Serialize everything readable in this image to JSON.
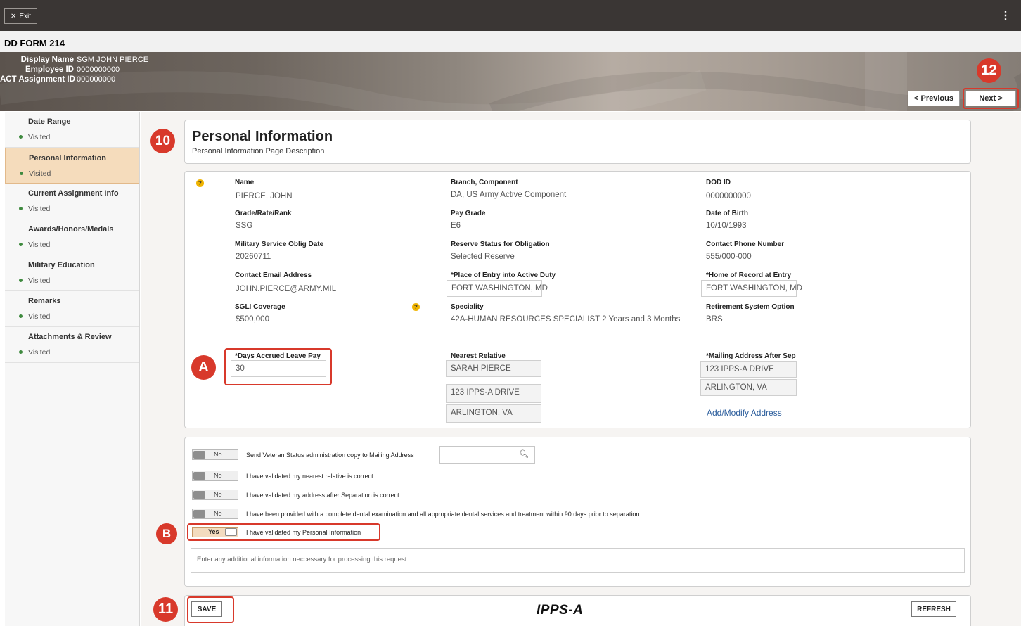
{
  "top_bar": {
    "exit_label": "Exit",
    "menu_icon": "kebab-menu-icon"
  },
  "form_title": "DD FORM 214",
  "employee": {
    "display_name_label": "Display Name",
    "display_name": "SGM JOHN PIERCE",
    "employee_id_label": "Employee ID",
    "employee_id": "0000000000",
    "assignment_id_label": "ACT Assignment ID",
    "assignment_id": "000000000"
  },
  "nav": {
    "previous_label": "< Previous",
    "next_label": "Next >"
  },
  "callouts": {
    "c10": "10",
    "c11": "11",
    "c12": "12",
    "cA": "A",
    "cB": "B"
  },
  "sidebar": {
    "items": [
      {
        "title": "Date Range",
        "status": "Visited"
      },
      {
        "title": "Personal Information",
        "status": "Visited",
        "active": true
      },
      {
        "title": "Current Assignment Info",
        "status": "Visited"
      },
      {
        "title": "Awards/Honors/Medals",
        "status": "Visited"
      },
      {
        "title": "Military Education",
        "status": "Visited"
      },
      {
        "title": "Remarks",
        "status": "Visited"
      },
      {
        "title": "Attachments & Review",
        "status": "Visited"
      }
    ]
  },
  "page": {
    "title": "Personal Information",
    "description": "Personal Information Page Description"
  },
  "fields": {
    "name": {
      "label": "Name",
      "value": "PIERCE, JOHN"
    },
    "branch": {
      "label": "Branch, Component",
      "value": "DA, US Army Active Component"
    },
    "dod_id": {
      "label": "DOD ID",
      "value": "0000000000"
    },
    "grade": {
      "label": "Grade/Rate/Rank",
      "value": "SSG"
    },
    "pay_grade": {
      "label": "Pay Grade",
      "value": "E6"
    },
    "dob": {
      "label": "Date of Birth",
      "value": "10/10/1993"
    },
    "mso_date": {
      "label": "Military Service Oblig Date",
      "value": "20260711"
    },
    "reserve_status": {
      "label": "Reserve Status for Obligation",
      "value": "Selected Reserve"
    },
    "phone": {
      "label": "Contact Phone Number",
      "value": "555/000-000"
    },
    "email": {
      "label": "Contact Email Address",
      "value": "JOHN.PIERCE@ARMY.MIL"
    },
    "place_entry": {
      "label": "*Place of Entry into Active Duty",
      "value": "FORT WASHINGTON, MD"
    },
    "home_record": {
      "label": "*Home of Record at Entry",
      "value": "FORT WASHINGTON, MD"
    },
    "sgli": {
      "label": "SGLI Coverage",
      "value": "$500,000"
    },
    "speciality": {
      "label": "Speciality",
      "value": "42A-HUMAN RESOURCES SPECIALIST 2 Years and 3 Months"
    },
    "retirement": {
      "label": "Retirement System Option",
      "value": "BRS"
    },
    "leave_pay": {
      "label": "*Days Accrued Leave Pay",
      "value": "30"
    },
    "nearest_relative": {
      "label": "Nearest Relative",
      "name": "SARAH PIERCE",
      "address1": "123 IPPS-A DRIVE",
      "address2": "ARLINGTON, VA"
    },
    "mailing_address": {
      "label": "*Mailing Address After Sep",
      "address1": "123 IPPS-A DRIVE",
      "address2": "ARLINGTON, VA"
    },
    "add_modify_link": "Add/Modify Address"
  },
  "checks": {
    "veteran_copy": {
      "state": "No",
      "label": "Send Veteran Status administration copy to Mailing Address"
    },
    "nearest_relative": {
      "state": "No",
      "label": "I have validated my nearest relative is correct"
    },
    "address_after_sep": {
      "state": "No",
      "label": "I have validated my address after Separation is correct"
    },
    "dental": {
      "state": "No",
      "label": "I have been provided with a complete dental examination and all appropriate dental services and treatment within 90 days prior to separation"
    },
    "personal_info": {
      "state": "Yes",
      "label": "I have validated my Personal Information"
    }
  },
  "additional_info_placeholder": "Enter any additional information neccessary for processing this request.",
  "footer": {
    "save_label": "SAVE",
    "refresh_label": "REFRESH",
    "logo_text": "IPPS-A"
  },
  "colors": {
    "callout": "#d8392b",
    "active_tab": "#f5dcbc",
    "link": "#2b5d9c",
    "topbar": "#3a3634"
  }
}
